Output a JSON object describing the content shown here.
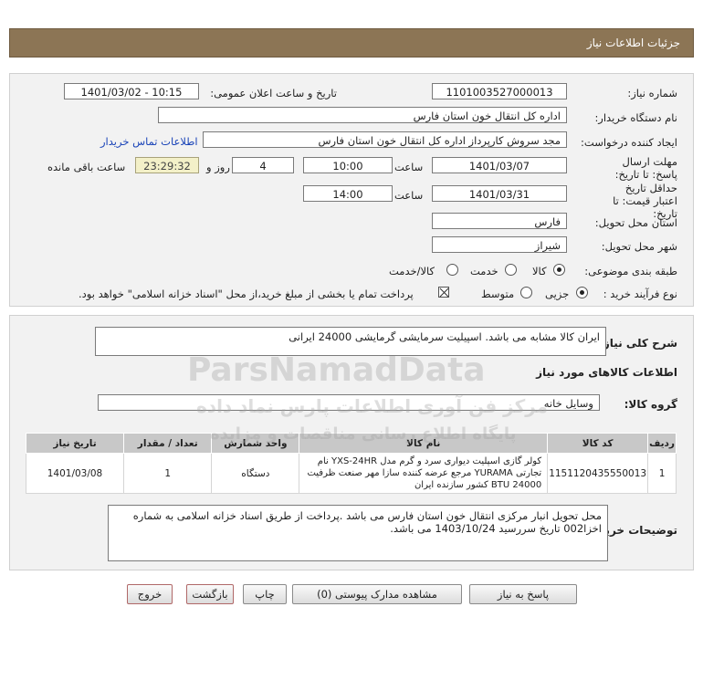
{
  "header": {
    "title": "جزئیات اطلاعات نیاز"
  },
  "form": {
    "need_number_label": "شماره نیاز:",
    "need_number": "1101003527000013",
    "announce_label": "تاریخ و ساعت اعلان عمومی:",
    "announce_value": "1401/03/02 - 10:15",
    "buyer_label": "نام دستگاه خریدار:",
    "buyer_value": "اداره کل انتقال خون استان فارس",
    "creator_label": "ایجاد کننده درخواست:",
    "creator_value": "مجد سروش کارپرداز اداره کل انتقال خون استان فارس",
    "contact_link": "اطلاعات تماس خریدار",
    "deadline_label": "مهلت ارسال پاسخ: تا تاریخ:",
    "deadline_date": "1401/03/07",
    "time_label": "ساعت",
    "deadline_time": "10:00",
    "days_value": "4",
    "days_label": "روز و",
    "remaining_time": "23:29:32",
    "remaining_label": "ساعت باقی مانده",
    "validity_label": "حداقل تاریخ اعتبار قیمت: تا تاریخ:",
    "validity_date": "1401/03/31",
    "validity_time_label": "ساعت",
    "validity_time": "14:00",
    "province_label": "استان محل تحویل:",
    "province_value": "فارس",
    "city_label": "شهر محل تحویل:",
    "city_value": "شیراز",
    "category_label": "طبقه بندی موضوعی:",
    "category_options": [
      "کالا",
      "خدمت",
      "کالا/خدمت"
    ],
    "process_label": "نوع فرآیند خرید :",
    "process_options": [
      "جزیی",
      "متوسط"
    ],
    "payment_note": "پرداخت تمام یا بخشی از مبلغ خرید،از محل \"اسناد خزانه اسلامی\" خواهد بود."
  },
  "summary": {
    "label": "شرح کلی نیاز:",
    "value": "ایران کالا مشابه می باشد. اسپیلیت سرمایشی گرمایشی 24000 ایرانی",
    "goods_heading": "اطلاعات کالاهای مورد نیاز",
    "group_label": "گروه کالا:",
    "group_value": "وسایل خانه"
  },
  "table": {
    "headers": [
      "ردیف",
      "کد کالا",
      "نام کالا",
      "واحد شمارش",
      "تعداد / مقدار",
      "تاریخ نیاز"
    ],
    "rows": [
      {
        "row": "1",
        "code": "1151120435550013",
        "name": "کولر گازی اسپلیت دیواری سرد و گرم مدل YXS-24HR نام تجارتی YURAMA مرجع عرضه کننده سازا مهر صنعت ظرفیت BTU 24000 کشور سازنده ایران",
        "unit": "دستگاه",
        "qty": "1",
        "date": "1401/03/08"
      }
    ]
  },
  "notes": {
    "label": "توضیحات خریدار:",
    "value": "محل تحویل انبار مرکزی انتقال خون استان فارس می باشد .پرداخت از طریق اسناد خزانه اسلامی به شماره اخزا002 تاریخ سررسید 1403/10/24 می باشد."
  },
  "buttons": {
    "reply": "پاسخ به نیاز",
    "attachments": "مشاهده مدارک پیوستی (0)",
    "print": "چاپ",
    "back": "بازگشت",
    "exit": "خروج"
  },
  "watermark": {
    "brand": "ParsNamadData",
    "line1": "پایگاه اطلاع رسانی مناقصات و مزایده",
    "line2": "مرکز فن آوری اطلاعات پارس نماد داده"
  }
}
